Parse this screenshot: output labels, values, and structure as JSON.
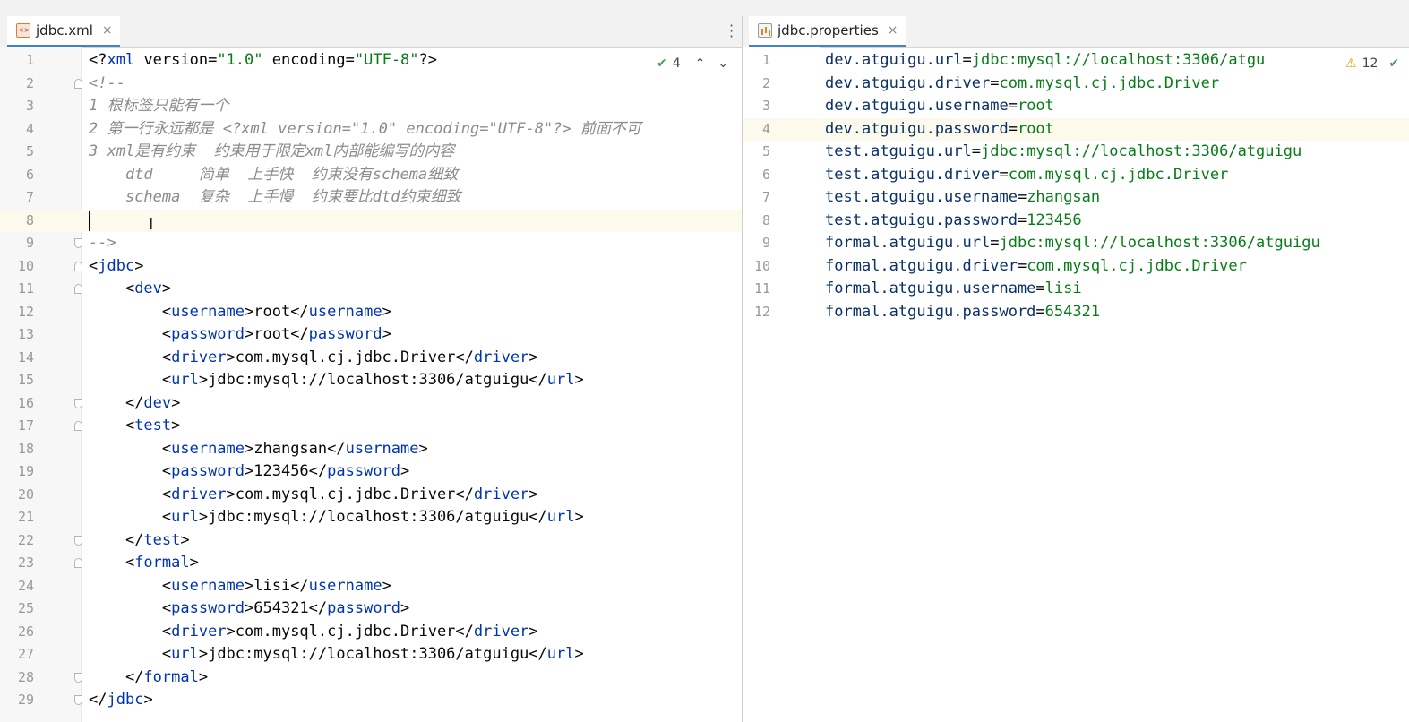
{
  "left_editor": {
    "tab_title": "jdbc.xml",
    "tab_close": "×",
    "inspection_count": "4",
    "up": "⌃",
    "down": "⌄",
    "lines": [
      {
        "n": "1",
        "code": "<?xml version=\"1.0\" encoding=\"UTF-8\"?>"
      },
      {
        "n": "2",
        "code": "<!--"
      },
      {
        "n": "3",
        "code": "1 根标签只能有一个"
      },
      {
        "n": "4",
        "code": "2 第一行永远都是 <?xml version=\"1.0\" encoding=\"UTF-8\"?> 前面不可"
      },
      {
        "n": "5",
        "code": "3 xml是有约束  约束用于限定xml内部能编写的内容"
      },
      {
        "n": "6",
        "code": "    dtd     简单  上手快  约束没有schema细致"
      },
      {
        "n": "7",
        "code": "    schema  复杂  上手慢  约束要比dtd约束细致"
      },
      {
        "n": "8",
        "code": ""
      },
      {
        "n": "9",
        "code": "-->"
      },
      {
        "n": "10",
        "code": "<jdbc>"
      },
      {
        "n": "11",
        "code": "    <dev>"
      },
      {
        "n": "12",
        "code": "        <username>root</username>"
      },
      {
        "n": "13",
        "code": "        <password>root</password>"
      },
      {
        "n": "14",
        "code": "        <driver>com.mysql.cj.jdbc.Driver</driver>"
      },
      {
        "n": "15",
        "code": "        <url>jdbc:mysql://localhost:3306/atguigu</url>"
      },
      {
        "n": "16",
        "code": "    </dev>"
      },
      {
        "n": "17",
        "code": "    <test>"
      },
      {
        "n": "18",
        "code": "        <username>zhangsan</username>"
      },
      {
        "n": "19",
        "code": "        <password>123456</password>"
      },
      {
        "n": "20",
        "code": "        <driver>com.mysql.cj.jdbc.Driver</driver>"
      },
      {
        "n": "21",
        "code": "        <url>jdbc:mysql://localhost:3306/atguigu</url>"
      },
      {
        "n": "22",
        "code": "    </test>"
      },
      {
        "n": "23",
        "code": "    <formal>"
      },
      {
        "n": "24",
        "code": "        <username>lisi</username>"
      },
      {
        "n": "25",
        "code": "        <password>654321</password>"
      },
      {
        "n": "26",
        "code": "        <driver>com.mysql.cj.jdbc.Driver</driver>"
      },
      {
        "n": "27",
        "code": "        <url>jdbc:mysql://localhost:3306/atguigu</url>"
      },
      {
        "n": "28",
        "code": "    </formal>"
      },
      {
        "n": "29",
        "code": "</jdbc>"
      }
    ]
  },
  "right_editor": {
    "tab_title": "jdbc.properties",
    "tab_close": "×",
    "warning_count": "12",
    "lines": [
      {
        "n": "1",
        "key": "dev.atguigu.url",
        "value": "jdbc:mysql://localhost:3306/atgu"
      },
      {
        "n": "2",
        "key": "dev.atguigu.driver",
        "value": "com.mysql.cj.jdbc.Driver"
      },
      {
        "n": "3",
        "key": "dev.atguigu.username",
        "value": "root"
      },
      {
        "n": "4",
        "key": "dev.atguigu.password",
        "value": "root"
      },
      {
        "n": "5",
        "key": "test.atguigu.url",
        "value": "jdbc:mysql://localhost:3306/atguigu"
      },
      {
        "n": "6",
        "key": "test.atguigu.driver",
        "value": "com.mysql.cj.jdbc.Driver"
      },
      {
        "n": "7",
        "key": "test.atguigu.username",
        "value": "zhangsan"
      },
      {
        "n": "8",
        "key": "test.atguigu.password",
        "value": "123456"
      },
      {
        "n": "9",
        "key": "formal.atguigu.url",
        "value": "jdbc:mysql://localhost:3306/atguigu"
      },
      {
        "n": "10",
        "key": "formal.atguigu.driver",
        "value": "com.mysql.cj.jdbc.Driver"
      },
      {
        "n": "11",
        "key": "formal.atguigu.username",
        "value": "lisi"
      },
      {
        "n": "12",
        "key": "formal.atguigu.password",
        "value": "654321"
      }
    ]
  },
  "colors": {
    "tag": "#0033b3",
    "string": "#067d17",
    "comment": "#8c8c8c",
    "tab_underline": "#4083c9"
  }
}
